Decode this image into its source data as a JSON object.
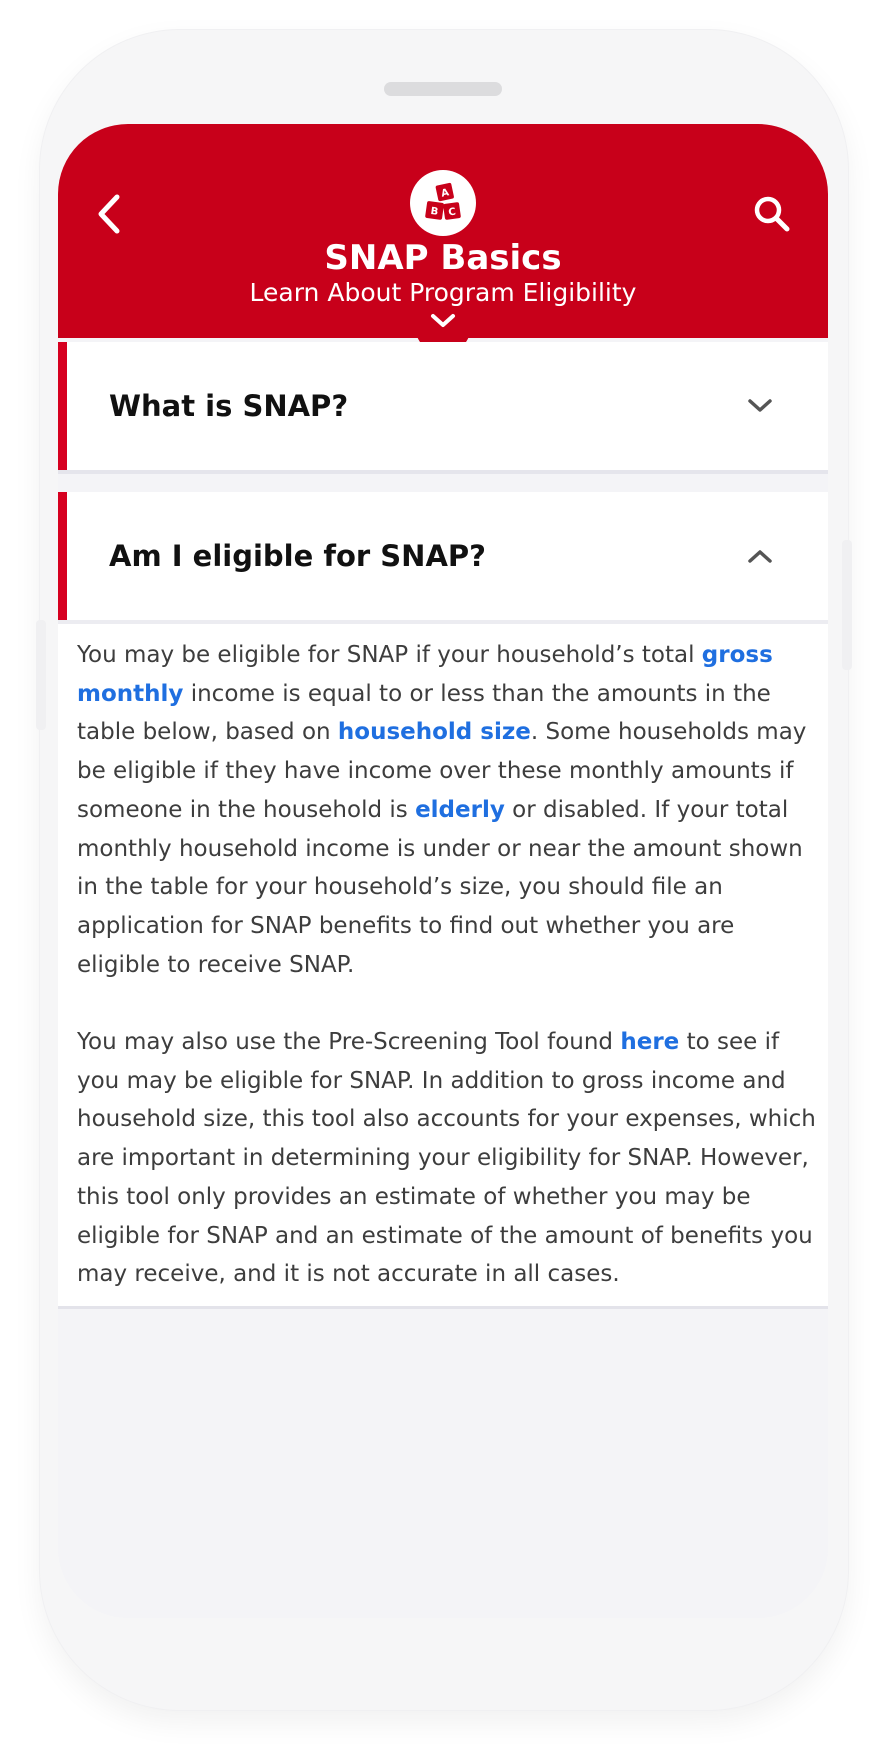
{
  "header": {
    "title": "SNAP Basics",
    "subtitle": "Learn About Program Eligibility",
    "logo_icon": "abc-blocks-icon",
    "back_icon": "chevron-left-icon",
    "search_icon": "search-icon",
    "expand_icon": "chevron-down-icon",
    "color": "#c8001a"
  },
  "accordion": [
    {
      "question": "What is SNAP?",
      "expanded": false
    },
    {
      "question": "Am I eligible for SNAP?",
      "expanded": true
    }
  ],
  "answer": {
    "p1_part1": "You may be eligible for SNAP if your household’s total ",
    "p1_link1": "gross monthly",
    "p1_part2": " income is equal to or less than the amounts in the table below, based on ",
    "p1_link2": "household size",
    "p1_part3": ". Some households may be eligible if they have income over these monthly amounts if someone in the household is ",
    "p1_link3": "elderly",
    "p1_part4": " or disabled. If your total monthly household income is under or near the amount shown in the table for your household’s size, you should file an application for SNAP benefits to find out whether you are eligible to receive SNAP.",
    "p2_part1": "You may also use the Pre-Screening Tool found ",
    "p2_link1": "here",
    "p2_part2": " to see if you may be eligible for SNAP.  In addition to gross income and household size, this tool also accounts for your expenses, which are important in determining your eligibility for SNAP.  However, this tool only provides an estimate of whether you may be eligible for SNAP and an estimate of the amount of benefits you may receive, and it is not accurate in all cases."
  },
  "colors": {
    "accent_red": "#d60020",
    "link_blue": "#1f6fe0",
    "body_text": "#3d3d3d"
  }
}
